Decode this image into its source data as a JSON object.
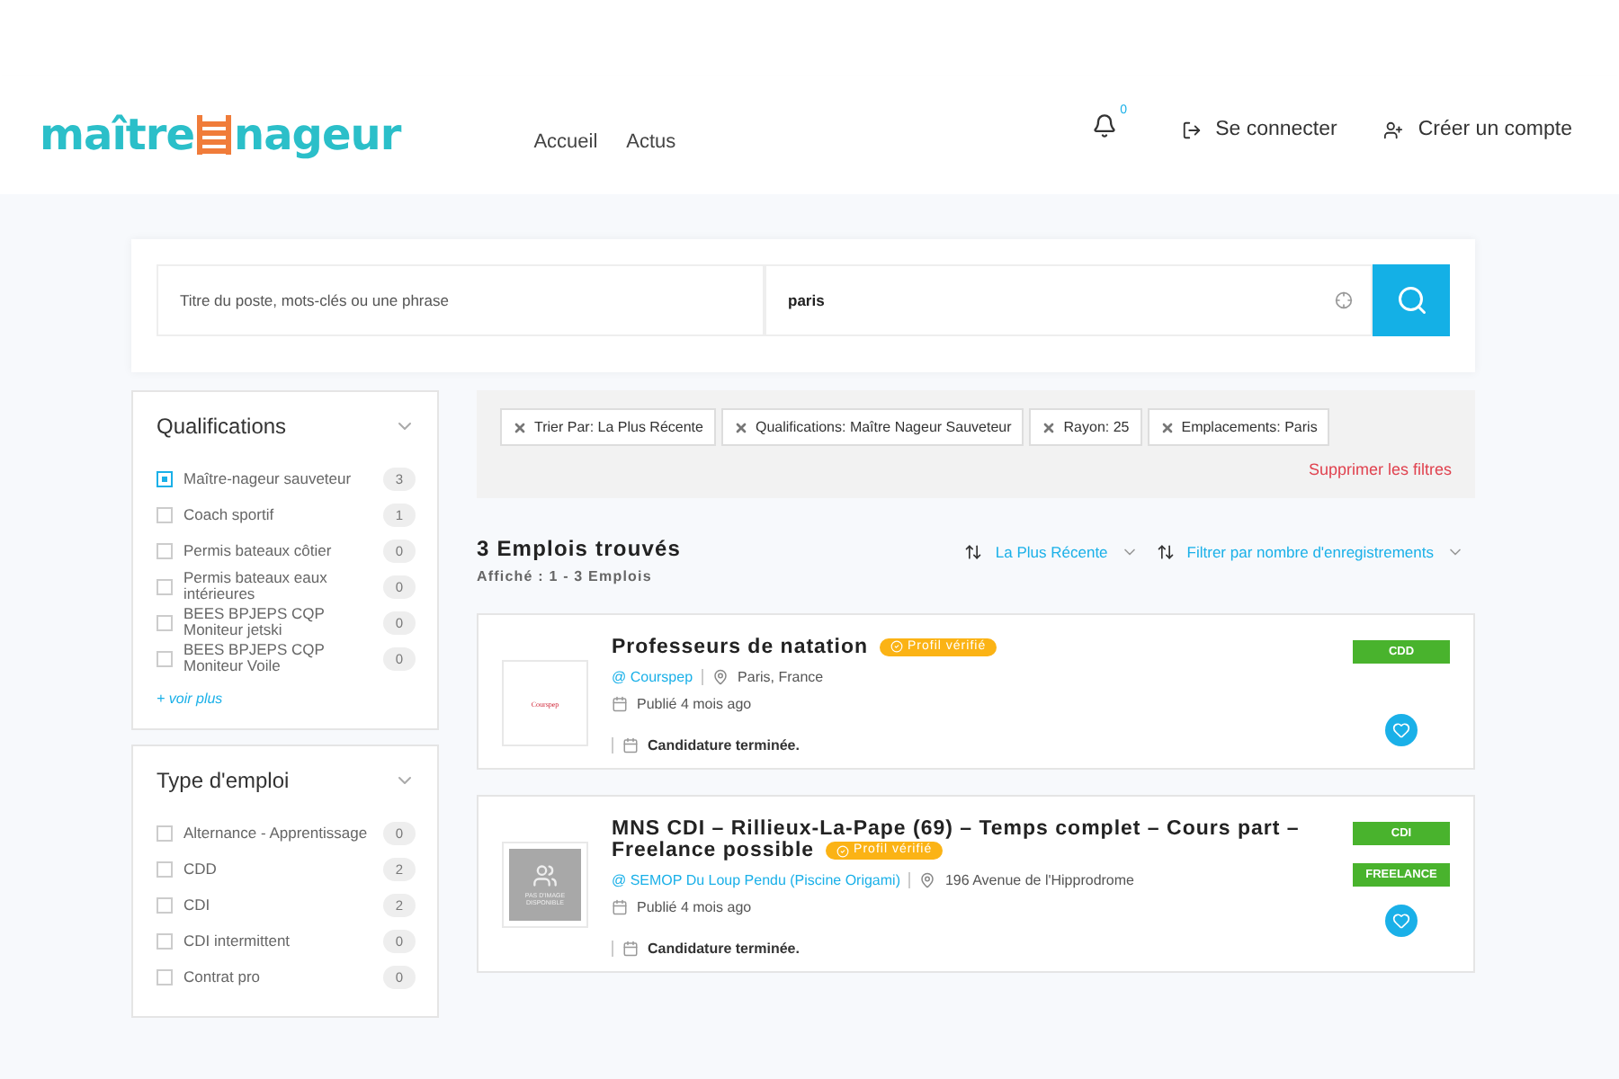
{
  "header": {
    "logo": {
      "part_1": "maître",
      "part_2": "nageur"
    },
    "nav": [
      {
        "label": "Accueil"
      },
      {
        "label": "Actus"
      }
    ],
    "notifications": {
      "count": "0"
    },
    "account_links": [
      {
        "kind": "login",
        "label": "Se connecter"
      },
      {
        "kind": "register",
        "label": "Créer un compte"
      }
    ]
  },
  "search": {
    "keyword": {
      "placeholder": "Titre du poste, mots-clés ou une phrase"
    },
    "location": {
      "value": "paris"
    }
  },
  "filters": [
    {
      "title": "Qualifications",
      "items": [
        {
          "label": "Maître-nageur sauveteur",
          "count": "3",
          "checked": true
        },
        {
          "label": "Coach sportif",
          "count": "1",
          "checked": false
        },
        {
          "label": "Permis bateaux côtier",
          "count": "0",
          "checked": false
        },
        {
          "label": "Permis bateaux eaux intérieures",
          "count": "0",
          "checked": false
        },
        {
          "label": "BEES BPJEPS CQP Moniteur jetski",
          "count": "0",
          "checked": false
        },
        {
          "label": "BEES BPJEPS CQP Moniteur Voile",
          "count": "0",
          "checked": false
        }
      ],
      "more": "+ voir plus"
    },
    {
      "title": "Type d'emploi",
      "items": [
        {
          "label": "Alternance - Apprentissage",
          "count": "0",
          "checked": false
        },
        {
          "label": "CDD",
          "count": "2",
          "checked": false
        },
        {
          "label": "CDI",
          "count": "2",
          "checked": false
        },
        {
          "label": "CDI intermittent",
          "count": "0",
          "checked": false
        },
        {
          "label": "Contrat pro",
          "count": "0",
          "checked": false
        }
      ]
    }
  ],
  "active_filters": {
    "tags": [
      "Trier Par: La Plus Récente",
      "Qualifications: Maître Nageur Sauveteur",
      "Rayon: 25",
      "Emplacements: Paris"
    ],
    "clear": "Supprimer les filtres"
  },
  "results": {
    "title": "3 Emplois trouvés",
    "subtitle": "Affiché : 1 - 3 Emplois",
    "sort": "La Plus Récente",
    "per_page": "Filtrer par nombre d'enregistrements"
  },
  "jobs": [
    {
      "title": "Professeurs de natation",
      "badge": "Profil vérifié",
      "logo": {
        "kind": "brand",
        "text": "Courspep"
      },
      "company": "@ Courspep",
      "location": "Paris, France",
      "published": "Publié 4 mois ago",
      "status": "Candidature terminée.",
      "types": [
        "CDD"
      ]
    },
    {
      "title": "MNS CDI – Rillieux-La-Pape (69) – Temps complet – Cours part – Freelance possible",
      "badge": "Profil vérifié",
      "logo": {
        "kind": "placeholder",
        "text": "PAS D'IMAGE DISPONIBLE"
      },
      "company": "@ SEMOP Du Loup Pendu (Piscine Origami)",
      "location": "196 Avenue de l'Hipprodrome",
      "published": "Publié 4 mois ago",
      "status": "Candidature terminée.",
      "types": [
        "CDI",
        "FREELANCE"
      ]
    }
  ]
}
